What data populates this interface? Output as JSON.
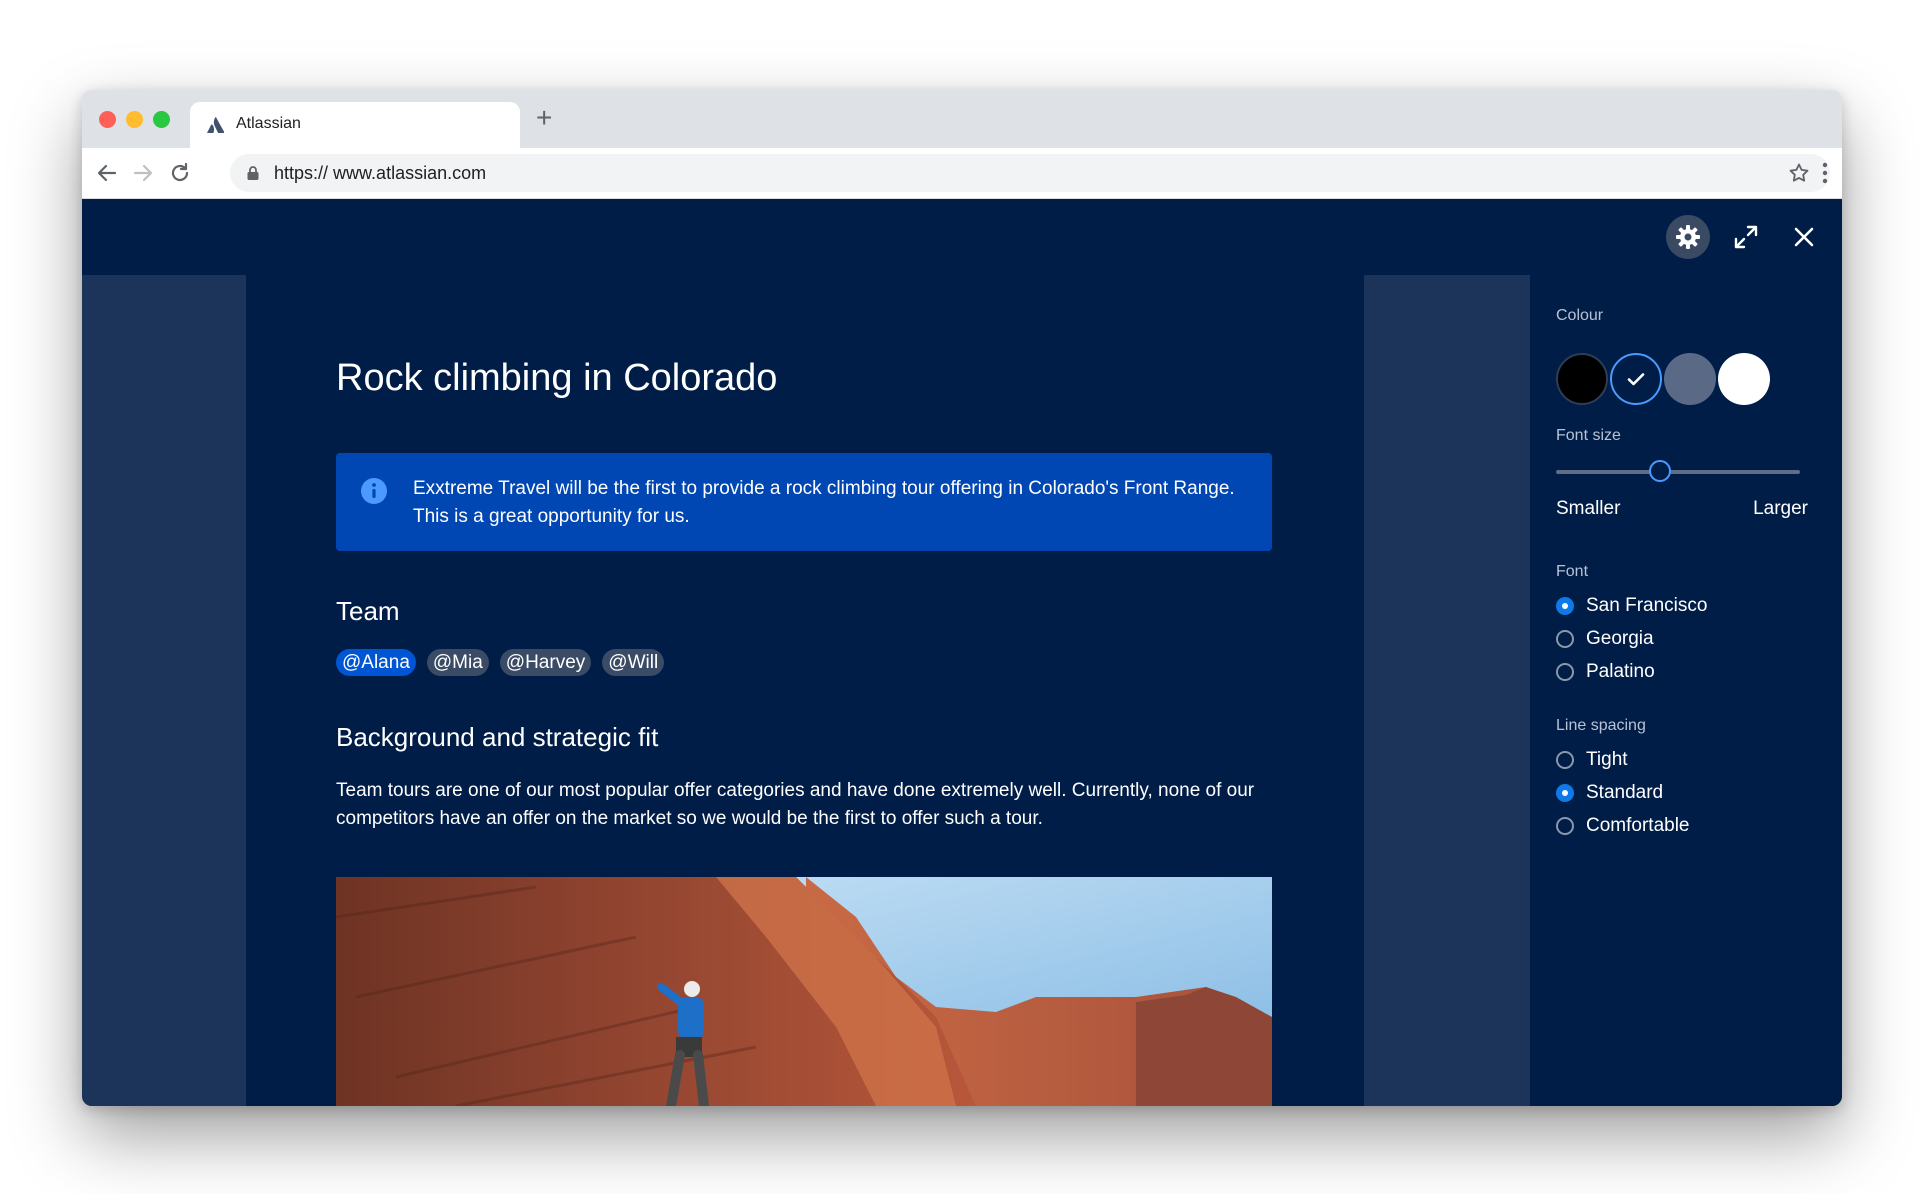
{
  "browser": {
    "tab_title": "Atlassian",
    "url_protocol": "https://",
    "url_host": "www.atlassian.com"
  },
  "document": {
    "title": "Rock climbing in Colorado",
    "info_panel": "Exxtreme Travel will be the first to provide a rock climbing tour offering in Colorado's Front Range. This is a great opportunity for us.",
    "team_heading": "Team",
    "mentions": [
      "@Alana",
      "@Mia",
      "@Harvey",
      "@Will"
    ],
    "background_heading": "Background and strategic fit",
    "background_text": "Team tours are one of our most popular offer categories and have done extremely well. Currently, none of our competitors have an offer on the market so we would be the first to offer such a tour."
  },
  "settings": {
    "colour_label": "Colour",
    "colours": [
      "#000000",
      "#001D47",
      "#5A6A86",
      "#FFFFFF"
    ],
    "selected_colour_index": 1,
    "font_size_label": "Font size",
    "font_size_min_label": "Smaller",
    "font_size_max_label": "Larger",
    "font_size_level": 0.43,
    "font_label": "Font",
    "fonts": [
      "San Francisco",
      "Georgia",
      "Palatino"
    ],
    "selected_font": "San Francisco",
    "line_spacing_label": "Line spacing",
    "line_spacings": [
      "Tight",
      "Standard",
      "Comfortable"
    ],
    "selected_line_spacing": "Standard"
  },
  "colors": {
    "page_bg": "#001D47",
    "side_bg": "#1C345A",
    "info_bg": "#0047B3",
    "accent": "#4C9AFF"
  }
}
